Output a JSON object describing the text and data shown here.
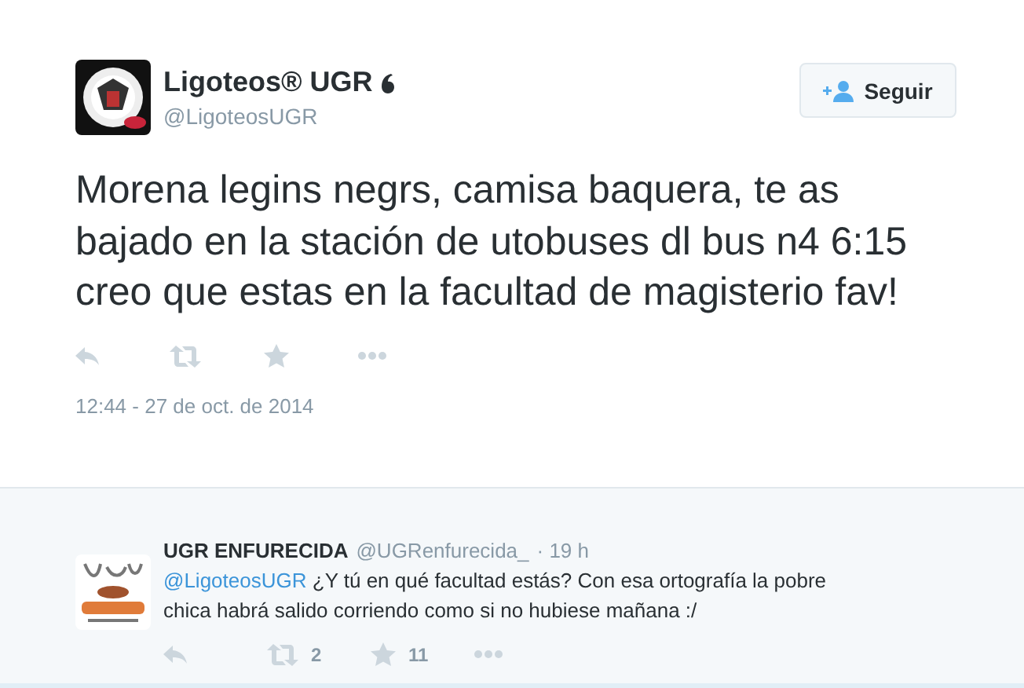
{
  "tweet": {
    "name": "Ligoteos® UGR",
    "handle": "@LigoteosUGR",
    "follow_button": "Seguir",
    "text": "Morena legins negrs, camisa baquera, te as bajado en la stación de utobuses dl bus n4 6:15 creo que estas en la facultad de magisterio fav!",
    "actions": [
      {
        "kind": "reply"
      },
      {
        "kind": "retweet"
      },
      {
        "kind": "favorite"
      },
      {
        "kind": "more"
      }
    ],
    "timestamp": "12:44 - 27 de oct. de 2014"
  },
  "reply": {
    "name": "UGR ENFURECIDA",
    "handle": "@UGRenfurecida_",
    "time": "· 19 h",
    "mention": "@LigoteosUGR",
    "text": "¿Y tú en qué facultad estás? Con esa ortografía la pobre chica habrá salido corriendo como si no hubiese mañana :/",
    "actions": [
      {
        "kind": "reply"
      },
      {
        "kind": "retweet",
        "count": "2"
      },
      {
        "kind": "favorite",
        "count": "11"
      },
      {
        "kind": "more"
      }
    ]
  }
}
